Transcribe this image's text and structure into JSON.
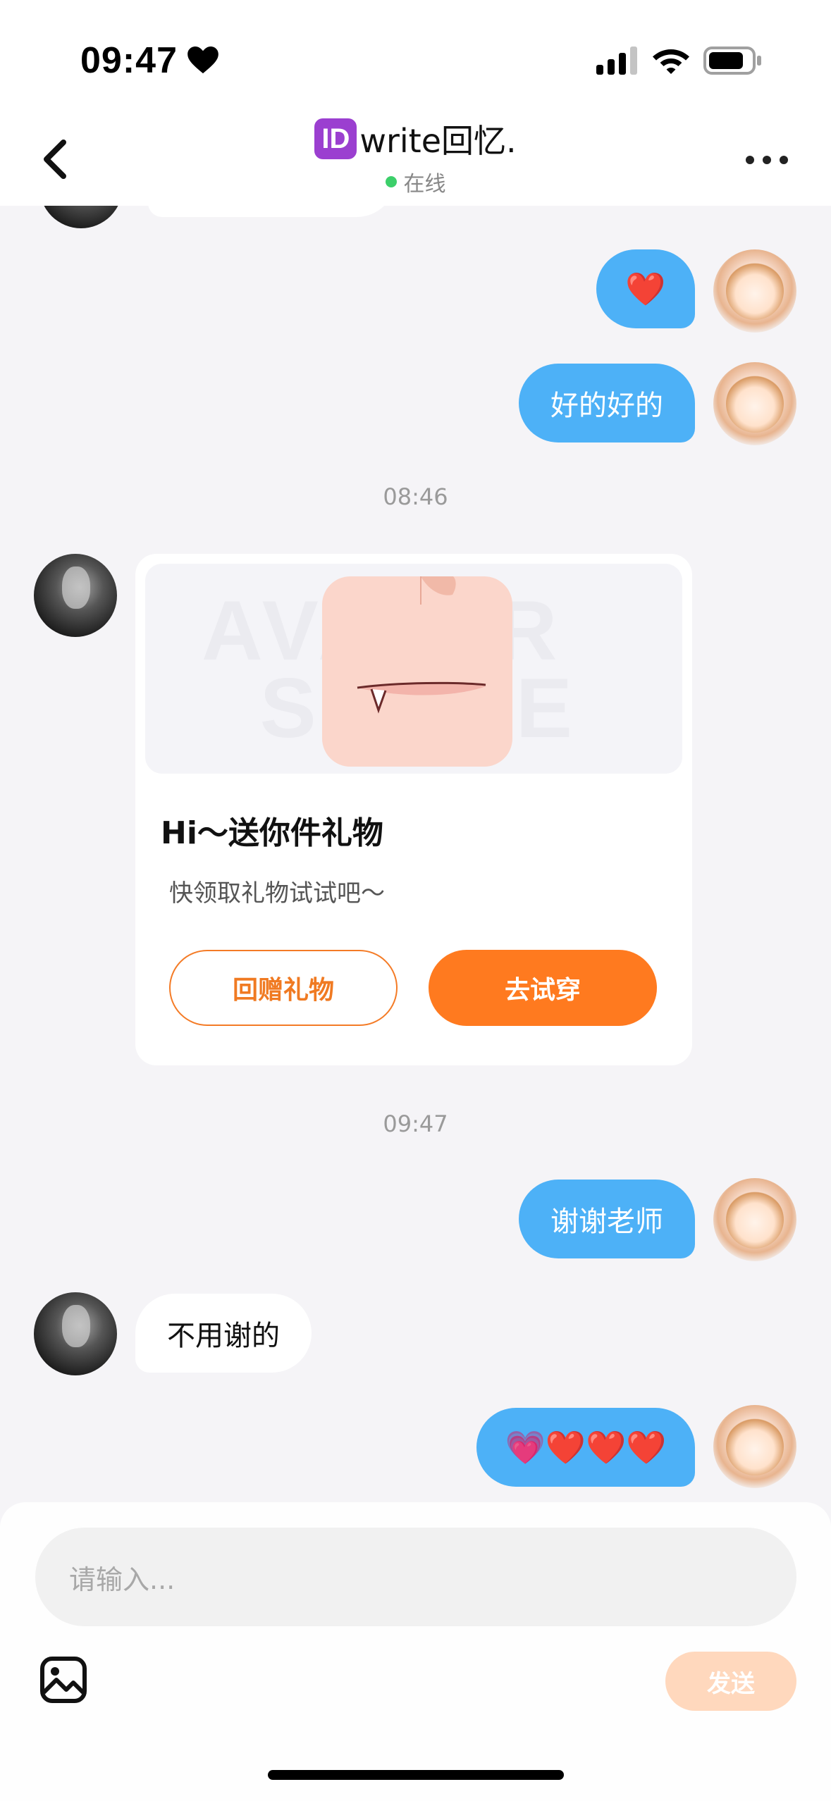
{
  "status_bar": {
    "time": "09:47",
    "heart_icon": "heart-icon",
    "signal_icon": "cellular-signal-icon",
    "wifi_icon": "wifi-icon",
    "battery_icon": "battery-icon"
  },
  "header": {
    "id_badge": "ID",
    "title": "write回忆.",
    "status": "在线",
    "status_color": "#3ccf6a",
    "back_icon": "chevron-left-icon",
    "more_icon": "more-dots-icon"
  },
  "messages": [
    {
      "side": "self",
      "text": "❤️"
    },
    {
      "side": "self",
      "text": "好的好的"
    },
    {
      "type": "timestamp",
      "text": "08:46"
    },
    {
      "side": "other",
      "type": "gift_card"
    },
    {
      "type": "timestamp",
      "text": "09:47"
    },
    {
      "side": "self",
      "text": "谢谢老师"
    },
    {
      "side": "other",
      "text": "不用谢的"
    },
    {
      "side": "self",
      "text": "💗❤️❤️❤️"
    }
  ],
  "gift_card": {
    "title": "Hi～送你件礼物",
    "subtitle": "快领取礼物试试吧～",
    "return_button": "回赠礼物",
    "try_button": "去试穿",
    "watermark": "AVATAR STORE"
  },
  "input": {
    "placeholder": "请输入...",
    "send_button": "发送",
    "image_icon": "image-icon"
  },
  "colors": {
    "self_bubble": "#4db1f7",
    "accent_orange": "#ff7a1f",
    "send_disabled": "#ffd8bd"
  }
}
